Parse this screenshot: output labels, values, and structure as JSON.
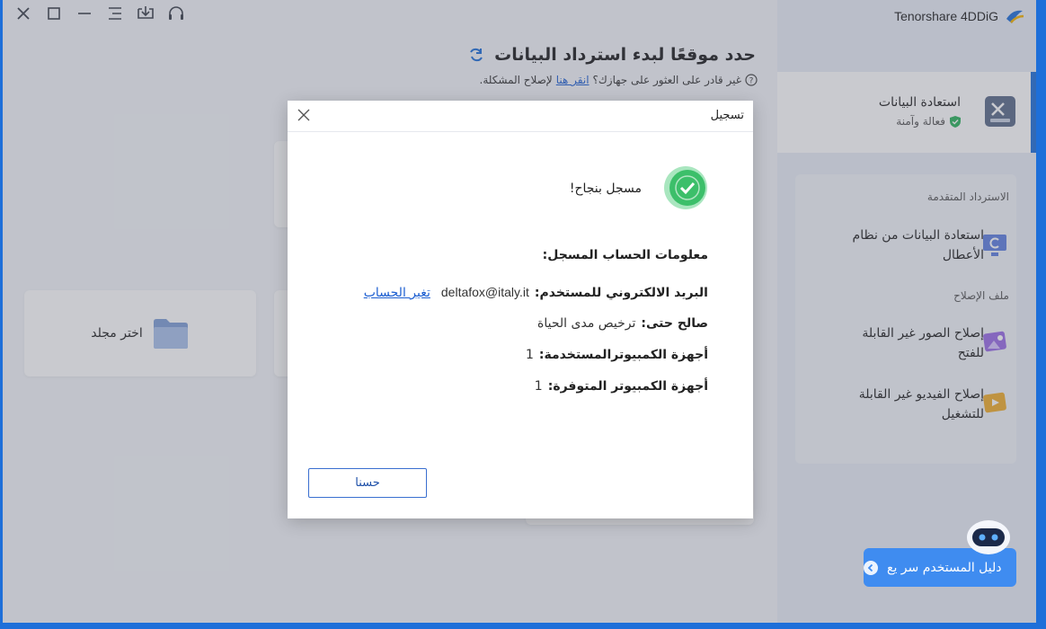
{
  "app": {
    "brand": "Tenorshare 4DDiG",
    "title": "حدد موقعًا لبدء استرداد البيانات",
    "subtitle_text": "غير قادر على العثور على جهازك؟",
    "subtitle_link": "انقر هنا",
    "subtitle_suffix": "لإصلاح المشكلة."
  },
  "main": {
    "folder_card_label": "اختر مجلد"
  },
  "sidebar": {
    "active": {
      "title": "استعادة البيانات",
      "status": "فعالة وآمنة"
    },
    "section_advanced": "الاسترداد المتقدمة",
    "crash_item": "استعادة البيانات من نظام الأعطال",
    "section_repair": "ملف الإصلاح",
    "photo_repair": "إصلاح الصور غير القابلة للفتح",
    "video_repair": "إصلاح الفيديو غير القابلة للتشغيل",
    "guide": "دليل المستخدم سر يع"
  },
  "dialog": {
    "title": "تسجيل",
    "success": "مسجل بنجاح!",
    "info_heading": "معلومات الحساب المسجل:",
    "email_label": "البريد الالكتروني للمستخدم:",
    "email_value": "deltafox@italy.it",
    "change_account": "تغير الحساب",
    "valid_label": "صالح حتى:",
    "valid_value": "ترخيص مدى الحياة",
    "used_label": "أجهزة الكمبيوترالمستخدمة:",
    "used_value": "1",
    "available_label": "أجهزة الكمبيوتر المتوفرة:",
    "available_value": "1",
    "ok_button": "حسنا"
  },
  "colors": {
    "accent": "#1e6fd9",
    "success": "#3cbf6a",
    "link": "#1d5fd1"
  },
  "icons": [
    "close-icon",
    "maximize-icon",
    "minimize-icon",
    "menu-icon",
    "download-icon",
    "headset-icon",
    "brand-logo-icon",
    "refresh-icon",
    "help-icon",
    "folder-icon",
    "data-recovery-icon",
    "shield-check-icon",
    "crash-recovery-icon",
    "photo-repair-icon",
    "video-repair-icon",
    "chevron-left-icon",
    "robot-icon",
    "check-circle-icon"
  ]
}
